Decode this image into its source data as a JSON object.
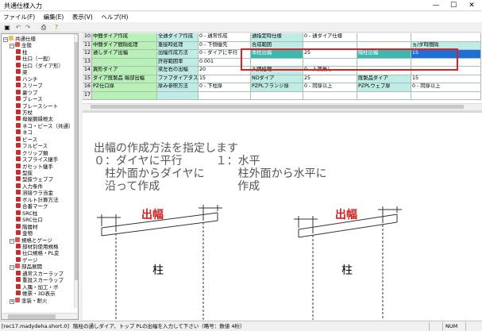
{
  "window": {
    "title": "共通仕様入力",
    "minimize": "—",
    "maximize": "☐",
    "close": "✕"
  },
  "menu": [
    "ファイル(F)",
    "編集(E)",
    "表示(V)",
    "ヘルプ(H)"
  ],
  "tree": [
    {
      "label": "共通仕様",
      "level": 0,
      "exp": "−",
      "icon": "folder",
      "color": "#e8c060"
    },
    {
      "label": "全般",
      "level": 1,
      "exp": "−",
      "icon": "folder",
      "color": "#e05050"
    },
    {
      "label": "柱",
      "level": 2,
      "icon": "item",
      "color": "#c03030"
    },
    {
      "label": "仕口（一般）",
      "level": 2,
      "icon": "item",
      "color": "#c03030"
    },
    {
      "label": "仕口（ダイア形）",
      "level": 2,
      "icon": "item",
      "color": "#c03030"
    },
    {
      "label": "梁",
      "level": 2,
      "icon": "item",
      "color": "#c03030"
    },
    {
      "label": "ハンチ",
      "level": 2,
      "icon": "item",
      "color": "#c03030"
    },
    {
      "label": "スリーブ",
      "level": 2,
      "icon": "item",
      "color": "#c03030"
    },
    {
      "label": "裏ツブ",
      "level": 2,
      "icon": "item",
      "color": "#c03030"
    },
    {
      "label": "ブレース",
      "level": 2,
      "icon": "item",
      "color": "#c03030"
    },
    {
      "label": "ブレースシート",
      "level": 2,
      "icon": "item",
      "color": "#c03030"
    },
    {
      "label": "方杖",
      "level": 2,
      "icon": "item",
      "color": "#c03030"
    },
    {
      "label": "母屋胴縁根太",
      "level": 2,
      "icon": "item",
      "color": "#c03030"
    },
    {
      "label": "ネコ・ピース（共通）",
      "level": 2,
      "icon": "item",
      "color": "#c03030"
    },
    {
      "label": "ネコ",
      "level": 2,
      "icon": "item",
      "color": "#c03030"
    },
    {
      "label": "ピース",
      "level": 2,
      "icon": "item",
      "color": "#c03030"
    },
    {
      "label": "フルピース",
      "level": 2,
      "icon": "item",
      "color": "#c03030"
    },
    {
      "label": "クリップ類",
      "level": 2,
      "icon": "item",
      "color": "#c03030"
    },
    {
      "label": "スプライス継手",
      "level": 2,
      "icon": "item",
      "color": "#c03030"
    },
    {
      "label": "ガセット継手",
      "level": 2,
      "icon": "item",
      "color": "#c03030"
    },
    {
      "label": "型抜",
      "level": 2,
      "icon": "item",
      "color": "#c03030"
    },
    {
      "label": "型抜ウェブプ",
      "level": 2,
      "icon": "item",
      "color": "#c03030"
    },
    {
      "label": "入力条件",
      "level": 2,
      "icon": "item",
      "color": "#c03030"
    },
    {
      "label": "溶接ウラ当金",
      "level": 2,
      "icon": "item",
      "color": "#c03030"
    },
    {
      "label": "ボルト計算方法",
      "level": 2,
      "icon": "item",
      "color": "#c03030"
    },
    {
      "label": "合番マーク",
      "level": 2,
      "icon": "item",
      "color": "#c03030"
    },
    {
      "label": "SRC柱",
      "level": 2,
      "icon": "item",
      "color": "#c03030"
    },
    {
      "label": "SRC仕口",
      "level": 2,
      "icon": "item",
      "color": "#c03030"
    },
    {
      "label": "階層材",
      "level": 2,
      "icon": "item",
      "color": "#c03030"
    },
    {
      "label": "金物",
      "level": 2,
      "icon": "item",
      "color": "#c03030"
    },
    {
      "label": "規格とゲージ",
      "level": 1,
      "exp": "−",
      "icon": "folder",
      "color": "#e05050"
    },
    {
      "label": "部材別使用規格",
      "level": 2,
      "icon": "item",
      "color": "#c03030"
    },
    {
      "label": "仕口規格・PL変",
      "level": 2,
      "icon": "item",
      "color": "#c03030"
    },
    {
      "label": "ゲージ",
      "level": 2,
      "icon": "item",
      "color": "#c03030"
    },
    {
      "label": "部品展開",
      "level": 1,
      "exp": "−",
      "icon": "folder",
      "color": "#e05050"
    },
    {
      "label": "通常スカーラップ",
      "level": 2,
      "icon": "item",
      "color": "#c03030"
    },
    {
      "label": "重設スカーラップ",
      "level": 2,
      "icon": "item",
      "color": "#c03030"
    },
    {
      "label": "入隅・加工・ボ",
      "level": 2,
      "icon": "item",
      "color": "#c03030"
    },
    {
      "label": "帳票・3D表示",
      "level": 2,
      "icon": "item",
      "color": "#c03030"
    },
    {
      "label": "塗装・耐火",
      "level": 1,
      "exp": "+",
      "icon": "folder",
      "color": "#e05050"
    }
  ],
  "grid": {
    "rows": [
      {
        "num": "10",
        "cells": [
          {
            "t": "中間ダイア作成",
            "k": "lb",
            "w": 82
          },
          {
            "t": "全通ダイア作成",
            "k": "hd",
            "w": 52
          },
          {
            "t": "0 - 通常作成",
            "k": "vl",
            "w": 66
          },
          {
            "t": "通指定時仕様",
            "k": "hd",
            "w": 66
          },
          {
            "t": "0 - 通ダイア仕様",
            "k": "vl",
            "w": 68
          },
          {
            "t": "",
            "k": "vl",
            "w": 68
          },
          {
            "t": "",
            "k": "vl",
            "w": 88
          }
        ]
      },
      {
        "num": "11",
        "cells": [
          {
            "t": "中間ダイア間隔処理",
            "k": "lb",
            "w": 82
          },
          {
            "t": "重接時処理",
            "k": "hd",
            "w": 52
          },
          {
            "t": "0 - 下側優先",
            "k": "vl",
            "w": 66
          },
          {
            "t": "合成範囲",
            "k": "hd",
            "w": 66
          },
          {
            "t": "",
            "k": "vl",
            "w": 68
          },
          {
            "t": "",
            "k": "vl",
            "w": 68
          },
          {
            "t": "ヵ/ダ時間隔",
            "k": "hd",
            "w": 88
          }
        ]
      },
      {
        "num": "12",
        "cells": [
          {
            "t": "通しダイア出幅",
            "k": "lb",
            "w": 82
          },
          {
            "t": "出幅作成方法",
            "k": "hd",
            "w": 52
          },
          {
            "t": "0 - ダイアに平行",
            "k": "vl",
            "w": 66
          },
          {
            "t": "本柱出幅",
            "k": "hl",
            "w": 66
          },
          {
            "t": "25",
            "k": "vl",
            "w": 68
          },
          {
            "t": "階柱出幅",
            "k": "hl",
            "w": 68
          },
          {
            "t": "15",
            "k": "sel",
            "w": 88
          }
        ]
      },
      {
        "num": "13",
        "cells": [
          {
            "t": "",
            "k": "lb",
            "w": 82
          },
          {
            "t": "許容範囲率",
            "k": "hd",
            "w": 52
          },
          {
            "t": "0.001",
            "k": "vl",
            "w": 66
          },
          {
            "t": "",
            "k": "vl",
            "w": 66
          },
          {
            "t": "",
            "k": "vl",
            "w": 68
          },
          {
            "t": "",
            "k": "vl",
            "w": 68
          },
          {
            "t": "",
            "k": "vl",
            "w": 88
          }
        ]
      },
      {
        "num": "14",
        "cells": [
          {
            "t": "異形ダイア",
            "k": "lb",
            "w": 82
          },
          {
            "t": "梁左右の出幅",
            "k": "hd",
            "w": 52
          },
          {
            "t": "20",
            "k": "vl",
            "w": 66
          },
          {
            "t": "入隅処理",
            "k": "hd",
            "w": 66
          },
          {
            "t": "0 - 入隅無し",
            "k": "vl",
            "w": 68
          },
          {
            "t": "",
            "k": "vl",
            "w": 68
          },
          {
            "t": "",
            "k": "vl",
            "w": 88
          }
        ]
      },
      {
        "num": "15",
        "cells": [
          {
            "t": "ダイア既製品 端部出幅",
            "k": "lb",
            "w": 82
          },
          {
            "t": "ファブダイアタス",
            "k": "hd",
            "w": 52
          },
          {
            "t": "15",
            "k": "vl",
            "w": 66
          },
          {
            "t": "NDダイア",
            "k": "hd",
            "w": 66
          },
          {
            "t": "25",
            "k": "vl",
            "w": 68
          },
          {
            "t": "既製品ダイア",
            "k": "hd",
            "w": 68
          },
          {
            "t": "15",
            "k": "vl",
            "w": 88
          }
        ]
      },
      {
        "num": "16",
        "cells": [
          {
            "t": "PZ仕口厚",
            "k": "lb",
            "w": 82
          },
          {
            "t": "厚み参照方法",
            "k": "hd",
            "w": 52
          },
          {
            "t": "0 - 下柱厚",
            "k": "vl",
            "w": 66
          },
          {
            "t": "PZPLフランジ厚",
            "k": "hd",
            "w": 66
          },
          {
            "t": "0 - 同厚以上",
            "k": "vl",
            "w": 68
          },
          {
            "t": "PZPLウェブ厚",
            "k": "hd",
            "w": 68
          },
          {
            "t": "0 - 同厚以上",
            "k": "vl",
            "w": 88
          }
        ]
      },
      {
        "num": "17",
        "cells": [
          {
            "t": "",
            "k": "lb",
            "w": 82
          },
          {
            "t": "",
            "k": "hd",
            "w": 52
          },
          {
            "t": "",
            "k": "vl",
            "w": 66
          },
          {
            "t": "",
            "k": "vl",
            "w": 66
          },
          {
            "t": "",
            "k": "vl",
            "w": 68
          },
          {
            "t": "",
            "k": "vl",
            "w": 68
          },
          {
            "t": "",
            "k": "vl",
            "w": 88
          }
        ]
      }
    ]
  },
  "help": {
    "line1": "出幅の作成方法を指定します",
    "line2": "０：ダイヤに平行　　　１：水平",
    "line3": "　柱外面からダイヤに　　　柱外面から水平に",
    "line4": "　沿って作成　　　　　　　作成",
    "fig_label_1": "出幅",
    "fig_label_2": "出幅",
    "col_label_1": "柱",
    "col_label_2": "柱"
  },
  "status": {
    "file": "[rec17.madydeha.short.0]",
    "message": "階柱の通しダイア、トップ PLの出幅を入力して下さい（略号：数値 4桁）",
    "num": "NUM"
  },
  "colors": {
    "highlight": "#e02020",
    "label_green": "#b8f0b8",
    "header_cyan": "#c0ece8",
    "select_blue": "#1e6fd6"
  }
}
